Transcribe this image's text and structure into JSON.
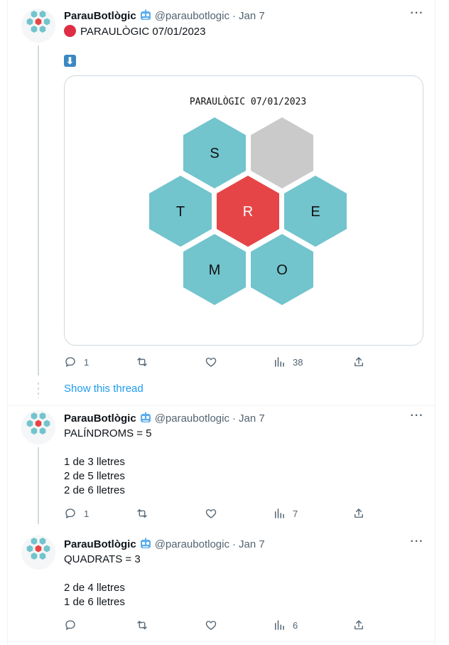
{
  "colors": {
    "teal": "#72c4cd",
    "red_center": "#e64547",
    "gray_tile": "#cacaca",
    "link": "#1d9bf0",
    "muted": "#536471"
  },
  "tweets": [
    {
      "name": "ParauBotlògic",
      "handle": "@paraubotlogic",
      "separator": "·",
      "date": "Jan 7",
      "title_line": "PARAULÒGIC 07/01/2023",
      "media": {
        "title": "PARAULÒGIC 07/01/2023",
        "center_letter": "R",
        "letters": {
          "top_left": "S",
          "top_right": "",
          "left": "T",
          "right": "E",
          "bottom_left": "M",
          "bottom_right": "O"
        }
      },
      "stats": {
        "replies": "1",
        "retweets": "",
        "likes": "",
        "views": "38"
      }
    },
    {
      "name": "ParauBotlògic",
      "handle": "@paraubotlogic",
      "separator": "·",
      "date": "Jan 7",
      "lines": [
        "PALÍNDROMS = 5",
        "1 de 3 lletres",
        "2 de 5 lletres",
        "2 de 6 lletres"
      ],
      "stats": {
        "replies": "1",
        "retweets": "",
        "likes": "",
        "views": "7"
      }
    },
    {
      "name": "ParauBotlògic",
      "handle": "@paraubotlogic",
      "separator": "·",
      "date": "Jan 7",
      "lines": [
        "QUADRATS = 3",
        "2 de 4 lletres",
        "1 de 6 lletres"
      ],
      "stats": {
        "replies": "",
        "retweets": "",
        "likes": "",
        "views": "6"
      }
    }
  ],
  "show_thread": "Show this thread",
  "icons": {
    "more": "more-icon",
    "reply": "reply-icon",
    "retweet": "retweet-icon",
    "like": "like-icon",
    "views": "views-icon",
    "share": "share-icon",
    "verified_emoji": "robot-icon",
    "red_dot": "red-circle-icon",
    "down_arrow": "down-arrow-icon"
  }
}
